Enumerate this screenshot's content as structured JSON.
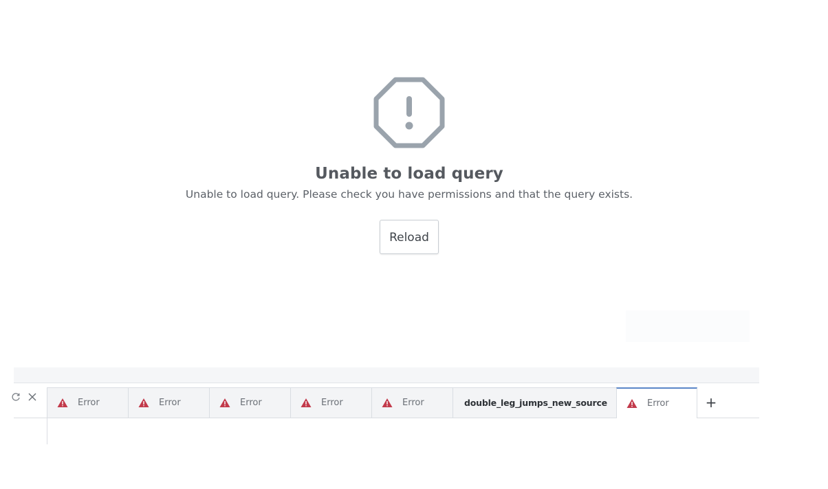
{
  "error": {
    "icon": "octagon-exclamation-icon",
    "title": "Unable to load query",
    "message": "Unable to load query. Please check you have permissions and that the query exists.",
    "reload_label": "Reload"
  },
  "tabbar": {
    "tabs": [
      {
        "label": "Error",
        "icon": "warning-triangle-icon",
        "status": "error"
      },
      {
        "label": "Error",
        "icon": "warning-triangle-icon",
        "status": "error"
      },
      {
        "label": "Error",
        "icon": "warning-triangle-icon",
        "status": "error"
      },
      {
        "label": "Error",
        "icon": "warning-triangle-icon",
        "status": "error"
      },
      {
        "label": "Error",
        "icon": "warning-triangle-icon",
        "status": "error"
      },
      {
        "label": "double_leg_jumps_new_source",
        "icon": "",
        "status": "ok"
      },
      {
        "label": "Error",
        "icon": "warning-triangle-icon",
        "status": "error",
        "active": true
      }
    ],
    "add_label": "+"
  },
  "colors": {
    "icon_gray": "#9aa3ac",
    "warning_red": "#c23a4b",
    "active_tab_accent": "#5a86c8"
  }
}
